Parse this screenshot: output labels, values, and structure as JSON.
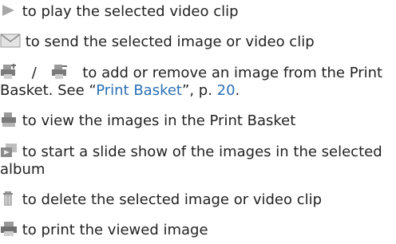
{
  "colors": {
    "text": "#222222",
    "link": "#2b6fb6",
    "icon_gray": "#a7a7a7",
    "icon_dark": "#6f6f6f"
  },
  "items": [
    {
      "icon": "play-icon",
      "text": " to play the selected video clip"
    },
    {
      "icon": "envelope-icon",
      "text": " to send the selected image or video clip"
    },
    {
      "icons": [
        "add-to-print-basket-icon",
        "remove-from-print-basket-icon"
      ],
      "separator": "/",
      "text_line1": "to add or remove an image from the Print",
      "text_line2_prefix": "Basket. See “",
      "link_text": "Print Basket",
      "text_line2_mid": "”, p. ",
      "page_number": "20",
      "text_line2_suffix": "."
    },
    {
      "icon": "print-basket-icon",
      "text": " to view the images in the Print Basket"
    },
    {
      "icon": "slideshow-icon",
      "text_line1": " to start a slide show of the images in the selected",
      "text_line2": "album"
    },
    {
      "icon": "trash-icon",
      "text": " to delete the selected image or video clip"
    },
    {
      "icon": "printer-icon",
      "text": " to print the viewed image"
    }
  ]
}
